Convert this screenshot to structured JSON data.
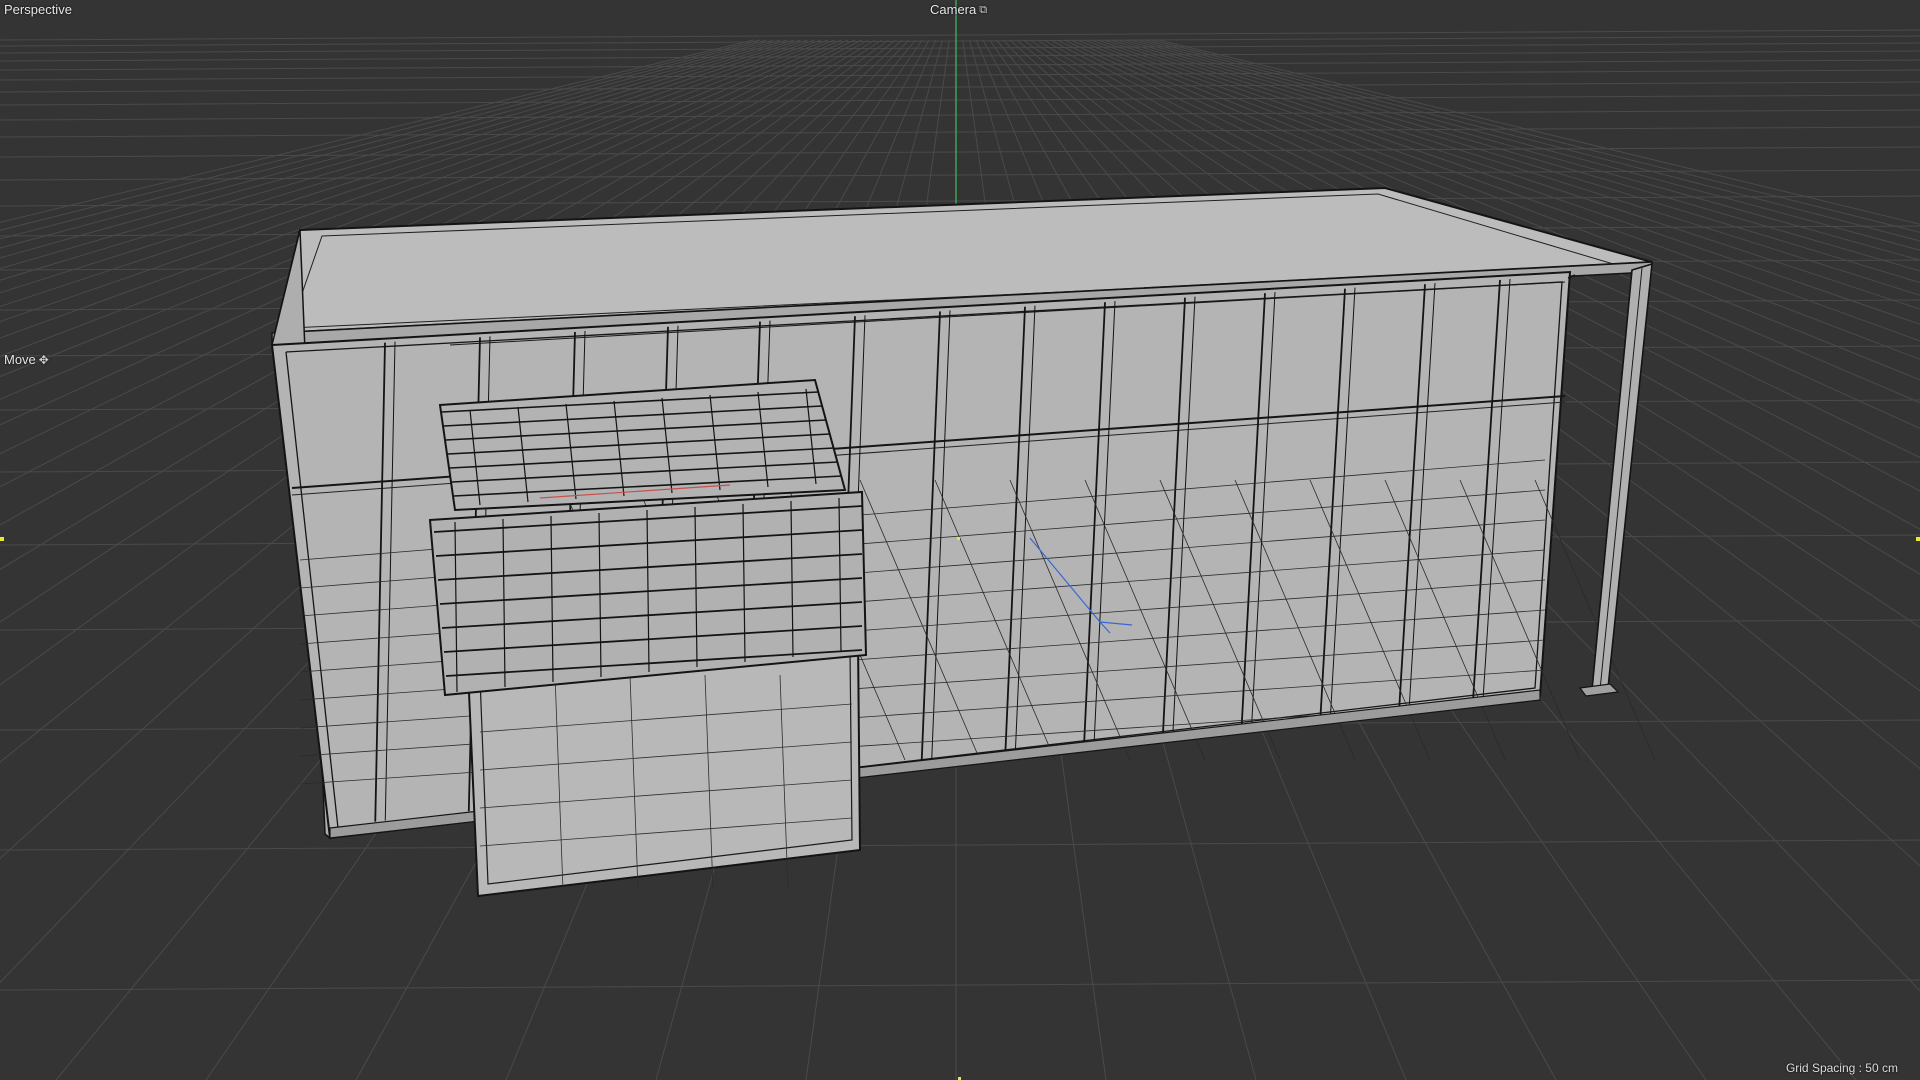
{
  "viewport": {
    "view_name": "Perspective",
    "camera_label": "Camera",
    "camera_icon": "camera-lock-icon",
    "tool_label": "Move",
    "tool_icon": "move-arrows-icon",
    "grid_spacing_label": "Grid Spacing : 50 cm"
  },
  "colors": {
    "background": "#343434",
    "grid_line": "#4a4a4a",
    "grid_major": "#3f3f3f",
    "model_fill": "#b4b4b4",
    "model_top": "#bcbcbc",
    "wire": "#141414",
    "y_axis": "#3fbf5f",
    "x_axis": "#c8504a",
    "z_axis": "#3a66d6",
    "marker": "#e8e830"
  }
}
